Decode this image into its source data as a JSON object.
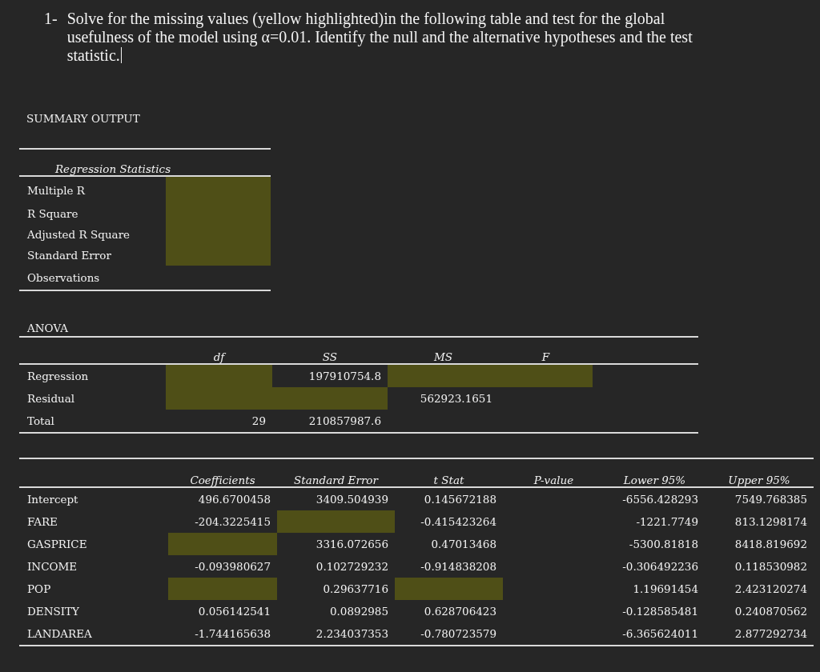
{
  "question": {
    "number": "1-",
    "text": "Solve for the missing values (yellow highlighted)in the following table and test for the global usefulness of the model using α=0.01. Identify the null and the alternative hypotheses and the test statistic.",
    "cursor": true
  },
  "summary_title": "SUMMARY OUTPUT",
  "regression_statistics": {
    "heading": "Regression Statistics",
    "rows": [
      {
        "label": "Multiple R",
        "cell": {
          "highlighted": true
        }
      },
      {
        "label": "R Square",
        "cell": {
          "highlighted": true
        }
      },
      {
        "label": "Adjusted R Square",
        "cell": {
          "highlighted": true
        }
      },
      {
        "label": "Standard Error",
        "cell": {
          "highlighted": true
        }
      },
      {
        "label": "Observations",
        "cell": {
          "highlighted": false
        }
      }
    ]
  },
  "anova": {
    "title": "ANOVA",
    "columns": [
      "df",
      "SS",
      "MS",
      "F"
    ],
    "rows": [
      {
        "label": "Regression",
        "cells": [
          {
            "highlighted": true
          },
          {
            "value": "197910754.8",
            "highlighted": false
          },
          {
            "highlighted": true
          },
          {
            "highlighted": true
          }
        ]
      },
      {
        "label": "Residual",
        "cells": [
          {
            "highlighted": true
          },
          {
            "highlighted": true
          },
          {
            "value": "562923.1651",
            "highlighted": false
          },
          {
            "highlighted": false
          }
        ]
      },
      {
        "label": "Total",
        "cells": [
          {
            "value": "29",
            "highlighted": false
          },
          {
            "value": "210857987.6",
            "highlighted": false
          },
          {
            "highlighted": false
          },
          {
            "highlighted": false
          }
        ]
      }
    ]
  },
  "coefficients": {
    "columns": [
      "Coefficients",
      "Standard Error",
      "t Stat",
      "P-value",
      "Lower 95%",
      "Upper 95%"
    ],
    "rows": [
      {
        "label": "Intercept",
        "cells": [
          {
            "value": "496.6700458",
            "highlighted": false
          },
          {
            "value": "3409.504939",
            "highlighted": false
          },
          {
            "value": "0.145672188",
            "highlighted": false
          },
          {
            "highlighted": false
          },
          {
            "value": "-6556.428293",
            "highlighted": false
          },
          {
            "value": "7549.768385",
            "highlighted": false
          }
        ]
      },
      {
        "label": "FARE",
        "cells": [
          {
            "value": "-204.3225415",
            "highlighted": false
          },
          {
            "highlighted": true
          },
          {
            "value": "-0.415423264",
            "highlighted": false
          },
          {
            "highlighted": false
          },
          {
            "value": "-1221.7749",
            "highlighted": false
          },
          {
            "value": "813.1298174",
            "highlighted": false
          }
        ]
      },
      {
        "label": "GASPRICE",
        "cells": [
          {
            "highlighted": true
          },
          {
            "value": "3316.072656",
            "highlighted": false
          },
          {
            "value": "0.47013468",
            "highlighted": false
          },
          {
            "highlighted": false
          },
          {
            "value": "-5300.81818",
            "highlighted": false
          },
          {
            "value": "8418.819692",
            "highlighted": false
          }
        ]
      },
      {
        "label": "INCOME",
        "cells": [
          {
            "value": "-0.093980627",
            "highlighted": false
          },
          {
            "value": "0.102729232",
            "highlighted": false
          },
          {
            "value": "-0.914838208",
            "highlighted": false
          },
          {
            "highlighted": false
          },
          {
            "value": "-0.306492236",
            "highlighted": false
          },
          {
            "value": "0.118530982",
            "highlighted": false
          }
        ]
      },
      {
        "label": "POP",
        "cells": [
          {
            "highlighted": true
          },
          {
            "value": "0.29637716",
            "highlighted": false
          },
          {
            "highlighted": true
          },
          {
            "highlighted": false
          },
          {
            "value": "1.19691454",
            "highlighted": false
          },
          {
            "value": "2.423120274",
            "highlighted": false
          }
        ]
      },
      {
        "label": "DENSITY",
        "cells": [
          {
            "value": "0.056142541",
            "highlighted": false
          },
          {
            "value": "0.0892985",
            "highlighted": false
          },
          {
            "value": "0.628706423",
            "highlighted": false
          },
          {
            "highlighted": false
          },
          {
            "value": "-0.128585481",
            "highlighted": false
          },
          {
            "value": "0.240870562",
            "highlighted": false
          }
        ]
      },
      {
        "label": "LANDAREA",
        "cells": [
          {
            "value": "-1.744165638",
            "highlighted": false
          },
          {
            "value": "2.234037353",
            "highlighted": false
          },
          {
            "value": "-0.780723579",
            "highlighted": false
          },
          {
            "highlighted": false
          },
          {
            "value": "-6.365624011",
            "highlighted": false
          },
          {
            "value": "2.877292734",
            "highlighted": false
          }
        ]
      }
    ]
  }
}
